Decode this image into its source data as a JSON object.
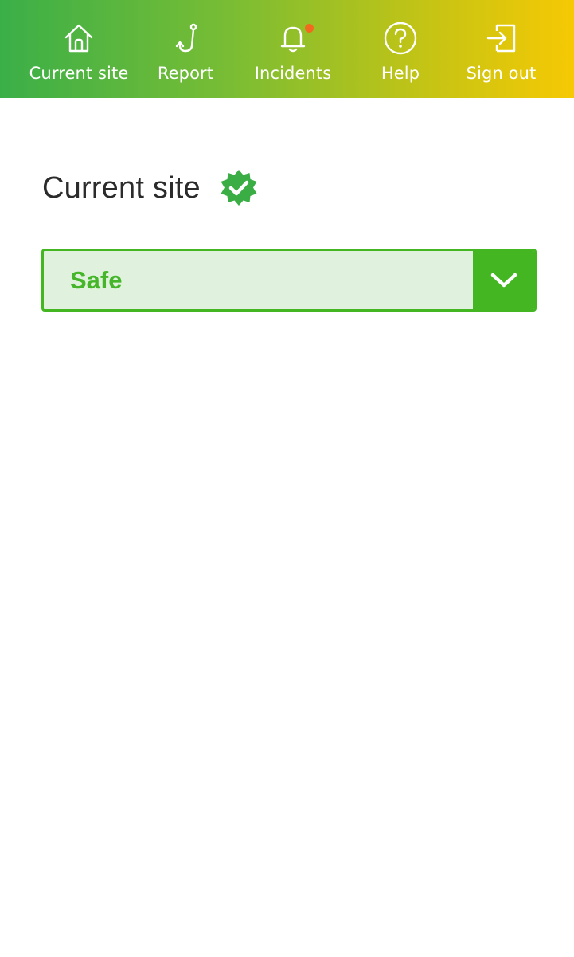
{
  "nav": {
    "items": [
      {
        "label": "Current site",
        "icon": "home-icon"
      },
      {
        "label": "Report",
        "icon": "hook-icon"
      },
      {
        "label": "Incidents",
        "icon": "bell-icon",
        "has_notification": true
      },
      {
        "label": "Help",
        "icon": "help-icon"
      },
      {
        "label": "Sign out",
        "icon": "sign-out-icon"
      }
    ],
    "gradient_colors": [
      "#3aaf48",
      "#79bd34",
      "#c6c414",
      "#f6c904"
    ],
    "notification_color": "#f26a1f"
  },
  "main": {
    "title": "Current site",
    "title_icon": "verified-badge-icon",
    "status_select": {
      "value": "Safe",
      "accent_color": "#43b621",
      "background_color": "#e0f2dd"
    }
  }
}
